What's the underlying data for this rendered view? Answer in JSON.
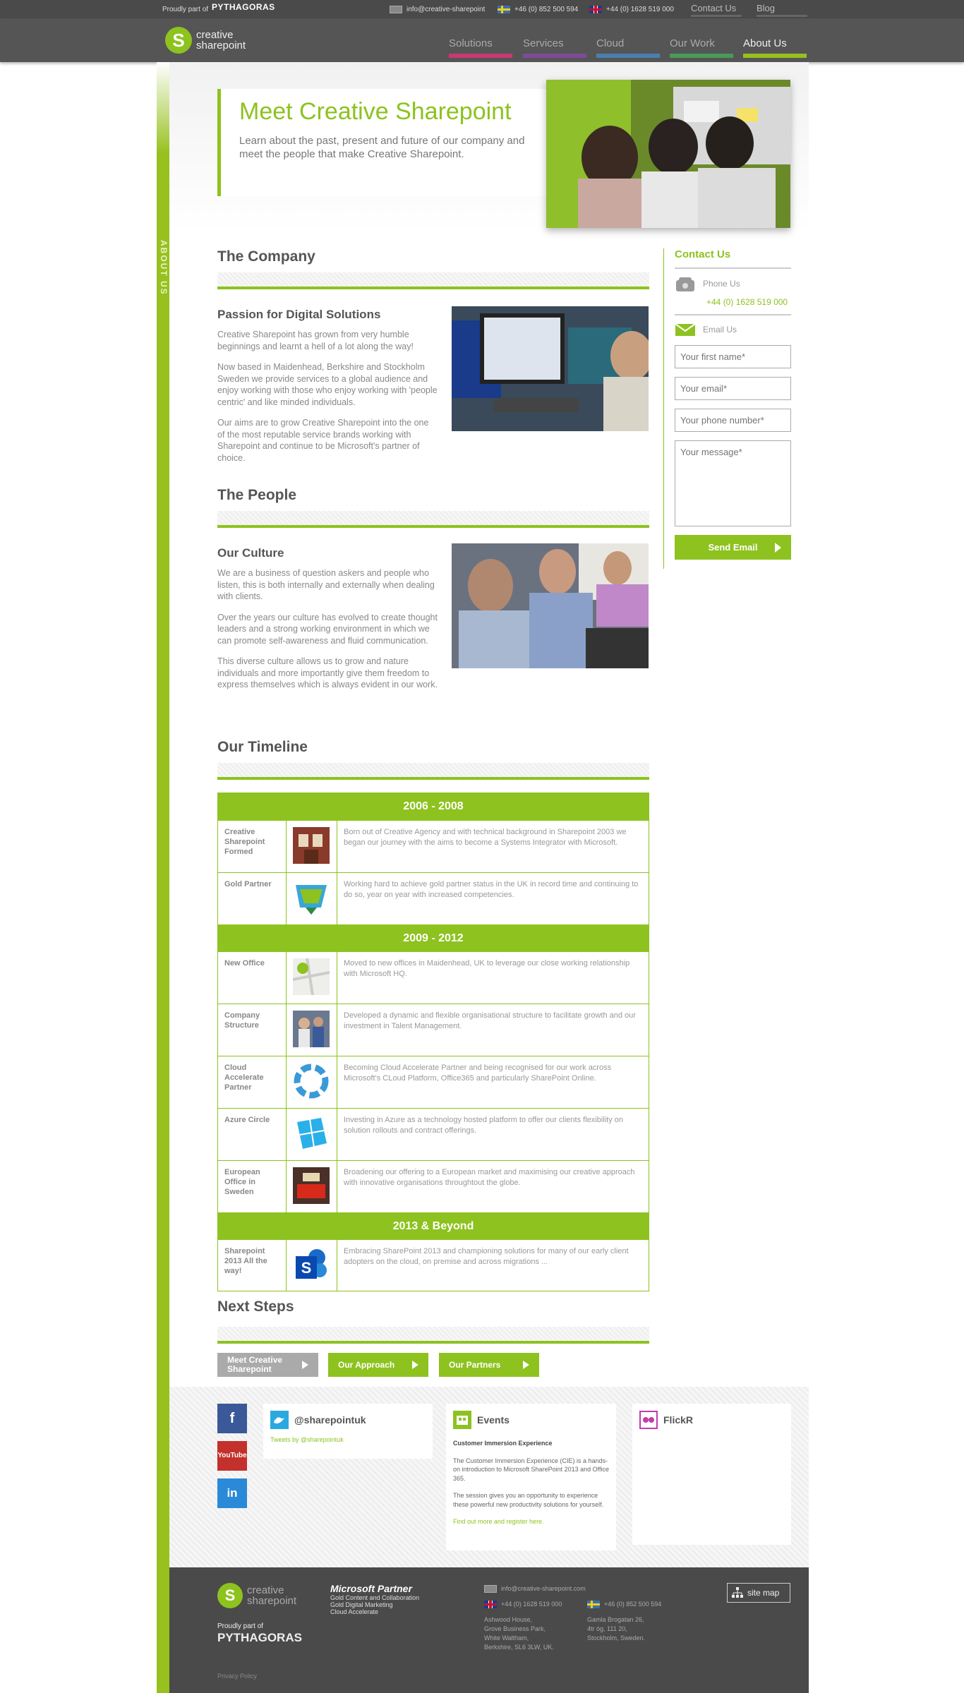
{
  "topbar": {
    "part_of": "Proudly part of",
    "brand": "PYTHAGORAS",
    "email": "info@creative-sharepoint",
    "phone_se": "+46 (0) 852 500 594",
    "phone_uk": "+44 (0) 1628 519 000",
    "contact_link": "Contact Us",
    "blog_link": "Blog"
  },
  "header": {
    "logo_line1": "creative",
    "logo_line2": "sharepoint",
    "nav": [
      "Solutions",
      "Services",
      "Cloud",
      "Our Work",
      "About Us"
    ],
    "nav_colors": [
      "#c93a6e",
      "#7c4b9a",
      "#4a7fb0",
      "#4a9a5a",
      "#97c11f"
    ]
  },
  "side_label": "ABOUT US",
  "hero": {
    "title": "Meet Creative Sharepoint",
    "subtitle": "Learn about the past, present and future of our company and meet the people that make Creative Sharepoint."
  },
  "company": {
    "title": "The Company",
    "subtitle": "Passion for Digital Solutions",
    "paragraphs": [
      "Creative Sharepoint has grown from very humble beginnings and learnt a hell of a lot along the way!",
      "Now based in Maidenhead, Berkshire and Stockholm Sweden we provide services to a global audience and enjoy working with those who enjoy working with 'people centric' and like minded individuals.",
      "Our aims are to grow Creative Sharepoint into the one of the most reputable service brands working with Sharepoint and continue to be Microsoft's partner of choice."
    ]
  },
  "people": {
    "title": "The People",
    "subtitle": "Our Culture",
    "paragraphs": [
      "We are a business of question askers and people who listen, this is both internally and externally when dealing with clients.",
      "Over the years our culture has evolved to create thought leaders and a strong working environment in which we can promote self-awareness and fluid communication.",
      "This diverse culture allows us to grow and nature individuals and more importantly give them freedom to express themselves which is always evident in our work."
    ]
  },
  "timeline": {
    "title": "Our Timeline",
    "groups": [
      {
        "period": "2006 - 2008"
      },
      {
        "period": "2009 - 2012"
      },
      {
        "period": "2013 & Beyond"
      }
    ],
    "rows": [
      {
        "label": "Creative Sharepoint Formed",
        "icon": "building-photo-icon",
        "desc": "Born out of Creative Agency and with technical background in Sharepoint 2003 we began our journey with the aims to become a Systems Integrator with Microsoft."
      },
      {
        "label": "Gold Partner",
        "icon": "gold-partner-icon",
        "desc": "Working hard to achieve gold partner status in the UK in record time and continuing to do so, year on year with increased competencies."
      },
      {
        "label": "New Office",
        "icon": "map-pin-icon",
        "desc": "Moved to new offices in Maidenhead, UK to leverage our close working relationship with Microsoft HQ."
      },
      {
        "label": "Company Structure",
        "icon": "team-photo-icon",
        "desc": "Developed a dynamic and flexible organisational structure to facilitate growth and our investment in Talent Management."
      },
      {
        "label": "Cloud Accelerate Partner",
        "icon": "cloud-accelerate-icon",
        "desc": "Becoming Cloud Accelerate Partner and being recognised for our work across Microsoft's CLoud Platform, Office365 and particularly SharePoint Online."
      },
      {
        "label": "Azure Circle",
        "icon": "azure-icon",
        "desc": "Investing in Azure as a technology hosted platform to offer our clients flexibility on solution rollouts and contract offerings."
      },
      {
        "label": "European Office in Sweden",
        "icon": "office-photo-icon",
        "desc": "Broadening our offering to a European market and maximising our creative approach with innovative organisations throughtout the globe."
      },
      {
        "label": "Sharepoint 2013 All the way!",
        "icon": "sharepoint-icon",
        "desc": "Embracing SharePoint 2013 and championing solutions for many of our early client adopters on the cloud, on premise and across migrations ..."
      }
    ]
  },
  "next_steps": {
    "title": "Next Steps",
    "buttons": [
      "Meet Creative Sharepoint",
      "Our Approach",
      "Our Partners"
    ]
  },
  "contact": {
    "title": "Contact Us",
    "phone_label": "Phone Us",
    "phone": "+44 (0) 1628 519 000",
    "email_label": "Email Us",
    "first_name_ph": "Your first name*",
    "email_ph": "Your email*",
    "phone_ph": "Your phone number*",
    "message_ph": "Your message*",
    "send": "Send Email"
  },
  "social": {
    "twitter_handle": "@sharepointuk",
    "tweets_by": "Tweets by @sharepointuk",
    "events_title": "Events",
    "event_name": "Customer Immersion Experience",
    "event_p1": "The Customer Immersion Experience (CIE) is a hands-on introduction to Microsoft SharePoint 2013 and Office 365.",
    "event_p2": "The session gives you an opportunity to experience these powerful new productivity solutions for yourself.",
    "event_link": "Find out more and register here.",
    "flickr_title": "FlickR",
    "youtube": "YouTube",
    "facebook": "f",
    "linkedin": "in"
  },
  "footer": {
    "logo_line1": "creative",
    "logo_line2": "sharepoint",
    "ms_partner": "Microsoft Partner",
    "ms_line1": "Gold Content and Collaboration",
    "ms_line2": "Gold Digital Marketing",
    "ms_line3": "Cloud Accelerate",
    "part_of": "Proudly part of",
    "brand": "PYTHAGORAS",
    "email": "info@creative-sharepoint.com",
    "phone_uk": "+44 (0) 1628 519 000",
    "phone_se": "+46 (0) 852 500 594",
    "addr_uk": [
      "Ashwood House,",
      "Grove Business Park,",
      "White Waltham,",
      "Berkshire, SL6 3LW, UK."
    ],
    "addr_se": [
      "Gamla Brogatan 26,",
      "4tr óg, 111 20,",
      "Stockholm, Sweden."
    ],
    "sitemap": "site map",
    "privacy": "Privacy Policy"
  }
}
